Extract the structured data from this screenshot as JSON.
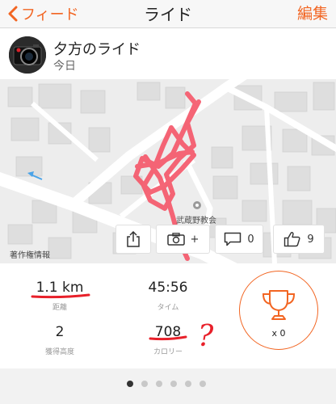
{
  "nav": {
    "back_label": "フィード",
    "title": "ライド",
    "edit_label": "編集"
  },
  "activity": {
    "title": "夕方のライド",
    "date": "今日"
  },
  "map": {
    "poi_label": "武蔵野教会",
    "copyright": "著作権情報"
  },
  "actions": {
    "photo_suffix": "+",
    "comment_count": "0",
    "kudos_count": "9"
  },
  "stats": [
    {
      "value": "1.1 km",
      "label": "距離"
    },
    {
      "value": "45:56",
      "label": "タイム"
    },
    {
      "value": "2",
      "label": "獲得高度"
    },
    {
      "value": "708",
      "label": "カロリー"
    }
  ],
  "achievements": {
    "count_label": "x 0"
  },
  "annotation": {
    "mark": "?"
  },
  "colors": {
    "accent": "#f26522",
    "route": "#f5596b",
    "annotation": "#e8202a"
  },
  "pager": {
    "pages": 6,
    "active": 1
  }
}
